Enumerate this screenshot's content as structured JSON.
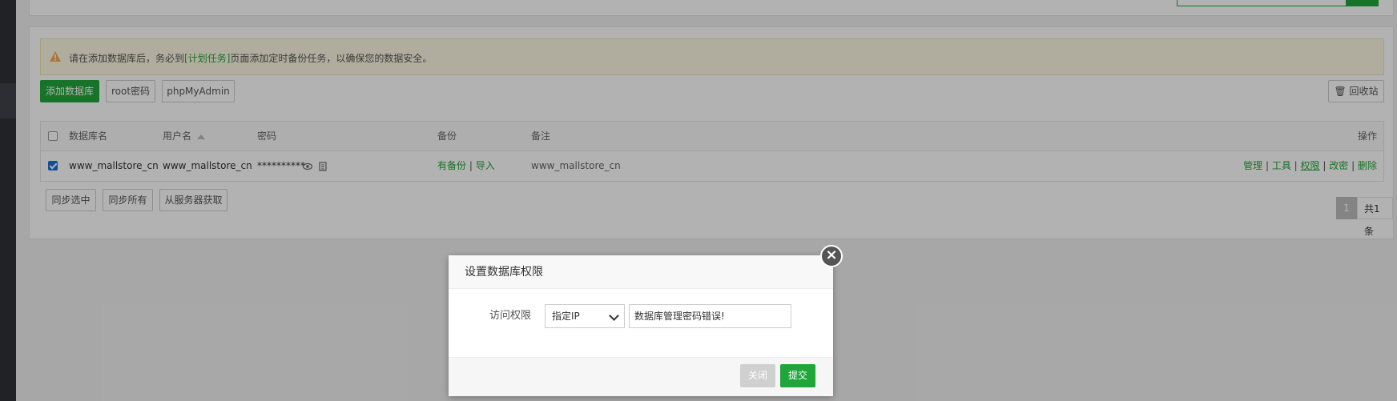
{
  "alert": {
    "text_before": "请在添加数据库后，务必到",
    "link": "[计划任务]",
    "text_after": "页面添加定时备份任务，以确保您的数据安全。"
  },
  "toolbar": {
    "add_db": "添加数据库",
    "root_password": "root密码",
    "phpmyadmin": "phpMyAdmin",
    "recycle_bin": "回收站"
  },
  "table": {
    "headers": {
      "name": "数据库名",
      "user": "用户名",
      "password": "密码",
      "backup": "备份",
      "note": "备注",
      "ops": "操作"
    },
    "rows": [
      {
        "checked": true,
        "name": "www_mallstore_cn",
        "user": "www_mallstore_cn",
        "password": "**********",
        "backup_status": "有备份",
        "import": "导入",
        "note": "www_mallstore_cn",
        "ops": [
          "管理",
          "工具",
          "权限",
          "改密",
          "删除"
        ]
      }
    ]
  },
  "bottom": {
    "sync_selected": "同步选中",
    "sync_all": "同步所有",
    "fetch_server": "从服务器获取"
  },
  "pager": {
    "current": "1",
    "total": "共1条"
  },
  "dialog": {
    "title": "设置数据库权限",
    "field_label": "访问权限",
    "select_value": "指定IP",
    "input_value": "数据库管理密码错误!",
    "close_btn": "关闭",
    "submit_btn": "提交"
  },
  "colors": {
    "accent": "#20a53a",
    "checkbox": "#1f6fd1"
  }
}
